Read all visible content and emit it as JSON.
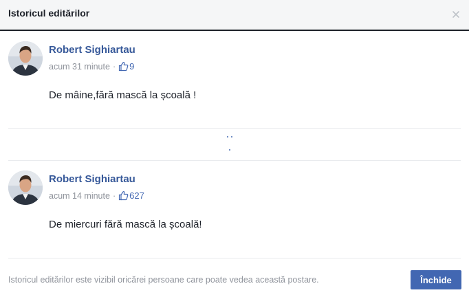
{
  "dialog": {
    "title": "Istoricul editărilor",
    "close_icon": "close-icon"
  },
  "posts": [
    {
      "author": "Robert Sighiartau",
      "time": "acum 31 minute",
      "separator": "·",
      "likes": "9",
      "text": "De mâine,fără mască la școală !",
      "like_icon": "thumbs-up-icon"
    },
    {
      "author": "Robert Sighiartau",
      "time": "acum 14 minute",
      "separator": "·",
      "likes": "627",
      "text": "De miercuri fără mască la școală!",
      "like_icon": "thumbs-up-icon"
    }
  ],
  "expand_icon": "more-dots-icon",
  "footer": {
    "note": "Istoricul editărilor este vizibil oricărei persoane care poate vedea această postare.",
    "close_label": "Închide"
  },
  "colors": {
    "accent": "#4267b2",
    "author_link": "#365899",
    "muted": "#90949c",
    "header_bg": "#f5f6f7"
  }
}
